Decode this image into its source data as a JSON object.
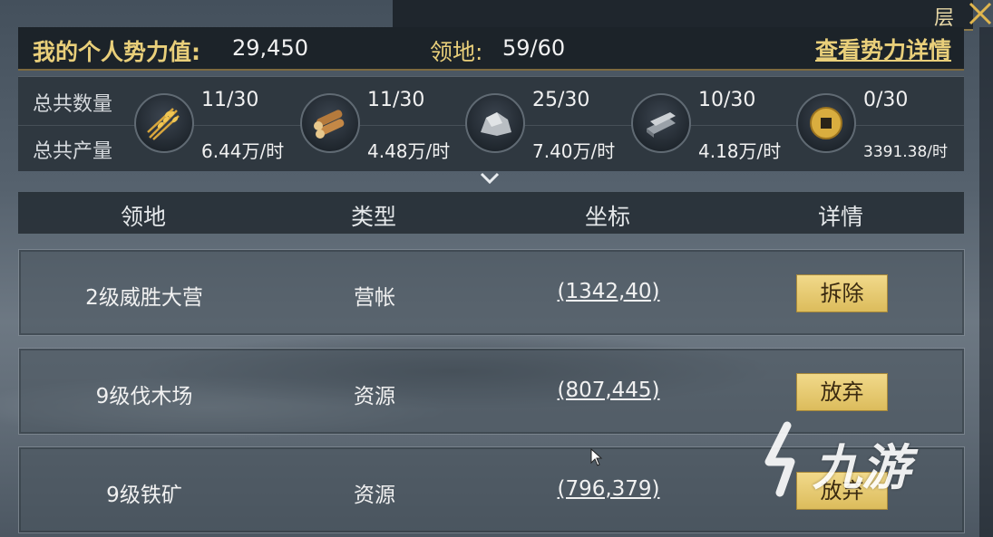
{
  "top_bar": {
    "glyph": "层"
  },
  "header": {
    "power_label": "我的个人势力值:",
    "power_value": "29,450",
    "territory_label": "领地:",
    "territory_value": "59/60",
    "detail_link": "查看势力详情"
  },
  "resources": {
    "count_label": "总共数量",
    "output_label": "总共产量",
    "items": [
      {
        "icon": "wheat-icon",
        "count": "11/30",
        "rate": "6.44万/时"
      },
      {
        "icon": "wood-logs-icon",
        "count": "11/30",
        "rate": "4.48万/时"
      },
      {
        "icon": "stone-icon",
        "count": "25/30",
        "rate": "7.40万/时"
      },
      {
        "icon": "iron-ingot-icon",
        "count": "10/30",
        "rate": "4.18万/时"
      },
      {
        "icon": "copper-coin-icon",
        "count": "0/30",
        "rate": "3391.38/时"
      }
    ]
  },
  "table": {
    "headers": [
      "领地",
      "类型",
      "坐标",
      "详情"
    ],
    "rows": [
      {
        "name": "2级威胜大营",
        "type": "营帐",
        "coord": "(1342,40)",
        "action": "拆除"
      },
      {
        "name": "9级伐木场",
        "type": "资源",
        "coord": "(807,445)",
        "action": "放弃"
      },
      {
        "name": "9级铁矿",
        "type": "资源",
        "coord": "(796,379)",
        "action": "放弃"
      }
    ]
  },
  "watermark": {
    "text": "九游"
  },
  "colors": {
    "gold": "#e9cf7a",
    "button": "#e8cb70",
    "panel": "#1c2329"
  }
}
